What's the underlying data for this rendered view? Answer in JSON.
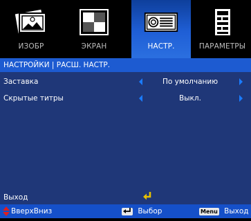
{
  "tabs": [
    {
      "label": "ИЗОБР",
      "icon": "image-icon",
      "active": false
    },
    {
      "label": "ЭКРАН",
      "icon": "screen-icon",
      "active": false
    },
    {
      "label": "НАСТР.",
      "icon": "projector-icon",
      "active": true
    },
    {
      "label": "ПАРАМЕТРЫ",
      "icon": "options-icon",
      "active": false
    }
  ],
  "header": {
    "breadcrumb": "НАСТРОЙКИ | РАСШ. НАСТР."
  },
  "menu": {
    "items": [
      {
        "label": "Заставка",
        "value": "По умолчанию"
      },
      {
        "label": "Скрытые титры",
        "value": "Выкл."
      }
    ],
    "exit_label": "Выход"
  },
  "footer": {
    "updown_label": "ВверхВниз",
    "enter_label": "Выбор",
    "menu_key": "Menu",
    "menu_label": "Выход"
  },
  "colors": {
    "active_tab": "#1f5fd6",
    "header": "#1d5bd1",
    "content": "#1f3778",
    "footer": "#1550c9",
    "arrow": "#1a7cff",
    "updown_icon": "#e01e1e",
    "enter_icon": "#e6c000"
  }
}
